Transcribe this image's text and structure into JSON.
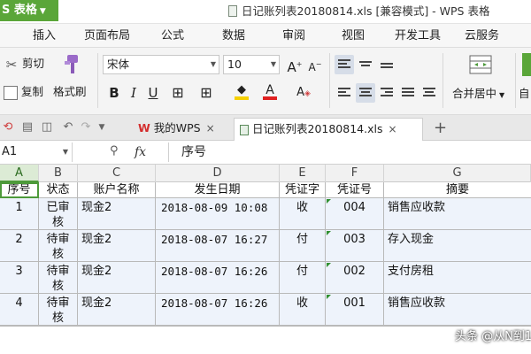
{
  "titlebar": {
    "app_label": "S 表格",
    "doc_title": "日记账列表20180814.xls [兼容模式] - WPS 表格"
  },
  "menu": [
    "插入",
    "页面布局",
    "公式",
    "数据",
    "审阅",
    "视图",
    "开发工具",
    "云服务"
  ],
  "ribbon": {
    "cut_label": "剪切",
    "copy_label": "复制",
    "format_painter_label": "格式刷",
    "font_name": "宋体",
    "font_size": "10",
    "merge_center_label": "合并居中",
    "auto_wrap_partial": "自",
    "bold": "B",
    "italic": "I",
    "underline": "U"
  },
  "tabs": {
    "home_tab": "我的WPS",
    "doc_tab": "日记账列表20180814.xls",
    "add": "+"
  },
  "formula_bar": {
    "cell_ref": "A1",
    "fx": "fx",
    "value": "序号"
  },
  "sheet": {
    "columns": [
      "A",
      "B",
      "C",
      "D",
      "E",
      "F",
      "G"
    ],
    "headers": [
      "序号",
      "状态",
      "账户名称",
      "发生日期",
      "凭证字",
      "凭证号",
      "摘要"
    ],
    "rows": [
      {
        "seq": "1",
        "status": "已审\n核",
        "account": "现金2",
        "date": "2018-08-09 10:08",
        "voucher_type": "收",
        "voucher_no": "004",
        "summary": "销售应收款"
      },
      {
        "seq": "2",
        "status": "待审\n核",
        "account": "现金2",
        "date": "2018-08-07 16:27",
        "voucher_type": "付",
        "voucher_no": "003",
        "summary": "存入现金"
      },
      {
        "seq": "3",
        "status": "待审\n核",
        "account": "现金2",
        "date": "2018-08-07 16:26",
        "voucher_type": "付",
        "voucher_no": "002",
        "summary": "支付房租"
      },
      {
        "seq": "4",
        "status": "待审\n核",
        "account": "现金2",
        "date": "2018-08-07 16:26",
        "voucher_type": "收",
        "voucher_no": "001",
        "summary": "销售应收款"
      }
    ]
  },
  "watermark": "头条 @从N到1",
  "colors": {
    "app_green": "#5aa639",
    "selection_green": "#4d9a3a",
    "row_tint": "#eef3fb",
    "comment_marker": "#2f8f2f"
  }
}
